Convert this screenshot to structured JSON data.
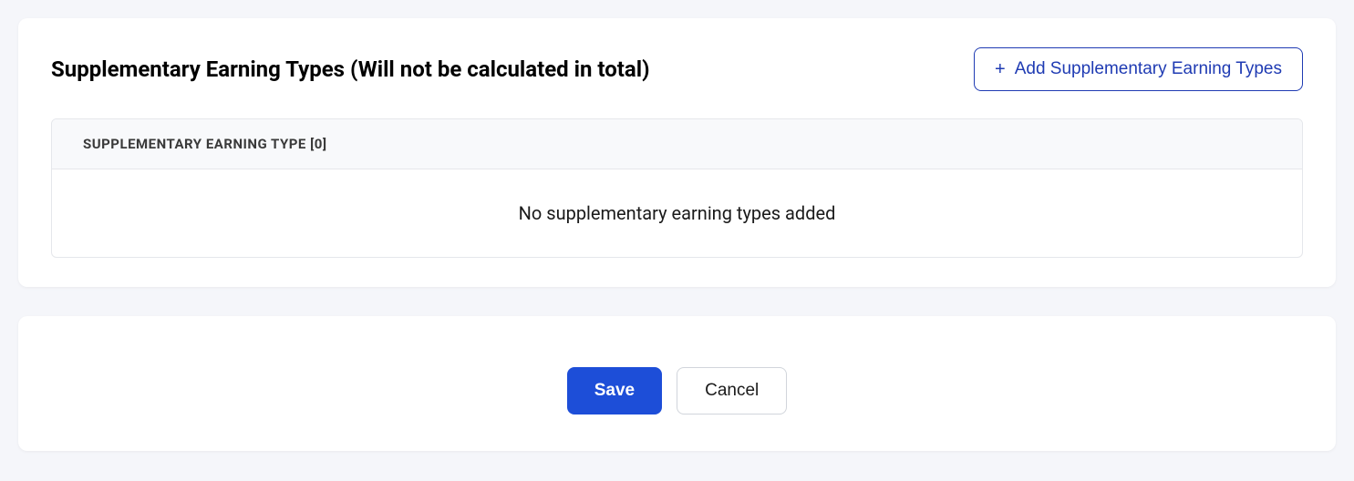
{
  "section": {
    "title": "Supplementary Earning Types (Will not be calculated in total)",
    "addButtonLabel": "Add Supplementary Earning Types",
    "table": {
      "headerLabel": "SUPPLEMENTARY EARNING TYPE [0]",
      "emptyMessage": "No supplementary earning types added"
    }
  },
  "actions": {
    "saveLabel": "Save",
    "cancelLabel": "Cancel"
  }
}
